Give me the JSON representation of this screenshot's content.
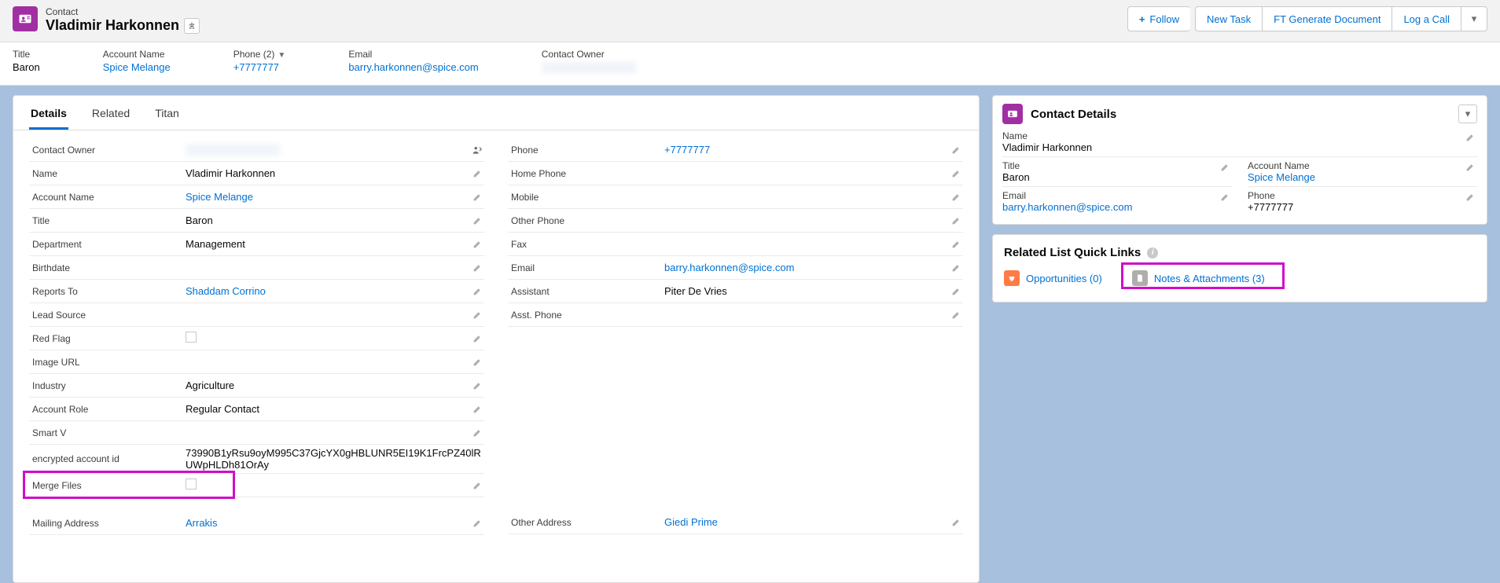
{
  "header": {
    "object_label": "Contact",
    "name": "Vladimir Harkonnen",
    "actions": {
      "follow": "Follow",
      "new_task": "New Task",
      "generate_doc": "FT Generate Document",
      "log_call": "Log a Call"
    }
  },
  "highlights": {
    "title_label": "Title",
    "title_value": "Baron",
    "account_label": "Account Name",
    "account_value": "Spice Melange",
    "phone_label": "Phone (2)",
    "phone_value": "+7777777",
    "email_label": "Email",
    "email_value": "barry.harkonnen@spice.com",
    "owner_label": "Contact Owner"
  },
  "tabs": {
    "details": "Details",
    "related": "Related",
    "titan": "Titan"
  },
  "details_left": {
    "contact_owner_l": "Contact Owner",
    "name_l": "Name",
    "name_v": "Vladimir Harkonnen",
    "account_l": "Account Name",
    "account_v": "Spice Melange",
    "title_l": "Title",
    "title_v": "Baron",
    "department_l": "Department",
    "department_v": "Management",
    "birthdate_l": "Birthdate",
    "reports_to_l": "Reports To",
    "reports_to_v": "Shaddam Corrino",
    "lead_source_l": "Lead Source",
    "red_flag_l": "Red Flag",
    "image_url_l": "Image URL",
    "industry_l": "Industry",
    "industry_v": "Agriculture",
    "account_role_l": "Account Role",
    "account_role_v": "Regular Contact",
    "smart_v_l": "Smart V",
    "enc_id_l": "encrypted account id",
    "enc_id_v": "73990B1yRsu9oyM995C37GjcYX0gHBLUNR5EI19K1FrcPZ40lRUWpHLDh81OrAy",
    "merge_files_l": "Merge Files",
    "mailing_addr_l": "Mailing Address",
    "mailing_addr_v": "Arrakis"
  },
  "details_right": {
    "phone_l": "Phone",
    "phone_v": "+7777777",
    "home_phone_l": "Home Phone",
    "mobile_l": "Mobile",
    "other_phone_l": "Other Phone",
    "fax_l": "Fax",
    "email_l": "Email",
    "email_v": "barry.harkonnen@spice.com",
    "assistant_l": "Assistant",
    "assistant_v": "Piter De Vries",
    "asst_phone_l": "Asst. Phone",
    "other_addr_l": "Other Address",
    "other_addr_v": "Giedi Prime"
  },
  "contact_details": {
    "title": "Contact Details",
    "name_l": "Name",
    "name_v": "Vladimir Harkonnen",
    "title_l": "Title",
    "title_v": "Baron",
    "account_l": "Account Name",
    "account_v": "Spice Melange",
    "email_l": "Email",
    "email_v": "barry.harkonnen@spice.com",
    "phone_l": "Phone",
    "phone_v": "+7777777"
  },
  "quick_links": {
    "title": "Related List Quick Links",
    "opportunities": "Opportunities (0)",
    "notes": "Notes & Attachments (3)"
  }
}
